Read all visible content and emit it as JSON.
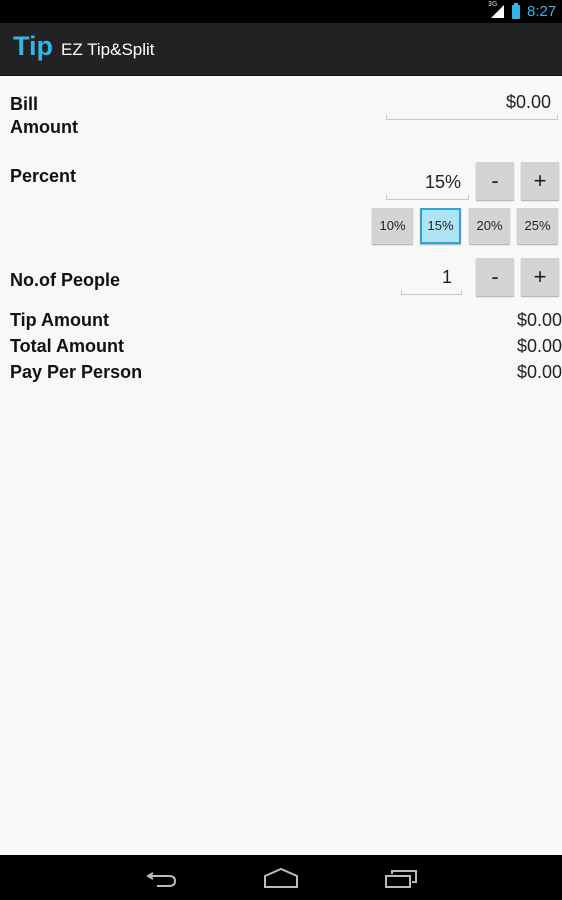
{
  "status_bar": {
    "network": "3G",
    "time": "8:27",
    "icons": [
      "signal-icon",
      "battery-charging-icon"
    ]
  },
  "action_bar": {
    "logo": "Tip",
    "title": "EZ Tip&Split"
  },
  "form": {
    "bill_label_line1": "Bill",
    "bill_label_line2": "Amount",
    "bill_value": "$0.00",
    "percent_label": "Percent",
    "percent_value": "15%",
    "minus_label": "-",
    "plus_label": "+",
    "presets": [
      {
        "label": "10%",
        "selected": false
      },
      {
        "label": "15%",
        "selected": true
      },
      {
        "label": "20%",
        "selected": false
      },
      {
        "label": "25%",
        "selected": false
      }
    ],
    "people_label": "No.of People",
    "people_value": "1"
  },
  "results": {
    "tip_label": "Tip Amount",
    "tip_value": "$0.00",
    "total_label": "Total Amount",
    "total_value": "$0.00",
    "per_person_label": "Pay Per Person",
    "per_person_value": "$0.00"
  },
  "nav_bar": {
    "buttons": [
      "back-icon",
      "home-icon",
      "recent-apps-icon"
    ]
  },
  "colors": {
    "accent": "#33b5e5",
    "action_bar_bg": "#222222",
    "selected_preset_bg": "#aee4f6",
    "button_bg": "#d4d4d4"
  }
}
